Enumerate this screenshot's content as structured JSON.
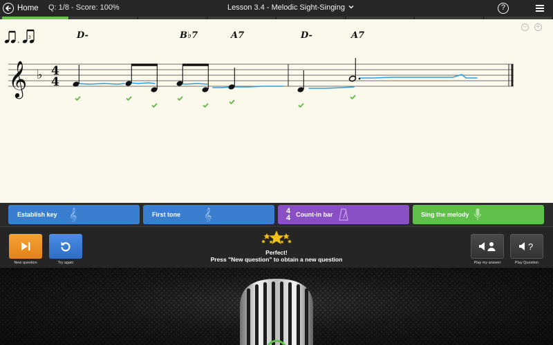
{
  "topbar": {
    "home_label": "Home",
    "score_text": "Q: 1/8 - Score: 100%",
    "lesson_title": "Lesson 3.4 - Melodic Sight-Singing",
    "help_label": "?"
  },
  "progress": {
    "current": 1,
    "total": 8
  },
  "sheet": {
    "chords": [
      "D-",
      "B♭7",
      "A7",
      "D-",
      "A7"
    ],
    "time_signature": {
      "top": "4",
      "bottom": "4"
    },
    "key_signature": "F major / D minor (one flat)"
  },
  "controls": {
    "establish_key": "Establish key",
    "first_tone": "First tone",
    "count_in": "Count-in bar",
    "count_in_ts": {
      "top": "4",
      "bottom": "4"
    },
    "sing": "Sing the melody"
  },
  "actions": {
    "new_question": "New question",
    "try_again": "Try again",
    "play_my_answer": "Play my answer",
    "play_question": "Play Question",
    "play_question_glyph": "?"
  },
  "feedback": {
    "title": "Perfect!",
    "message": "Press \"New question\" to obtain a new question"
  },
  "colors": {
    "accent_blue": "#3a7fcf",
    "accent_purple": "#8a4fc4",
    "accent_green": "#5ec048",
    "accent_orange": "#f6a233",
    "pitch_trace": "#2a9fe0",
    "check": "#62b847"
  }
}
